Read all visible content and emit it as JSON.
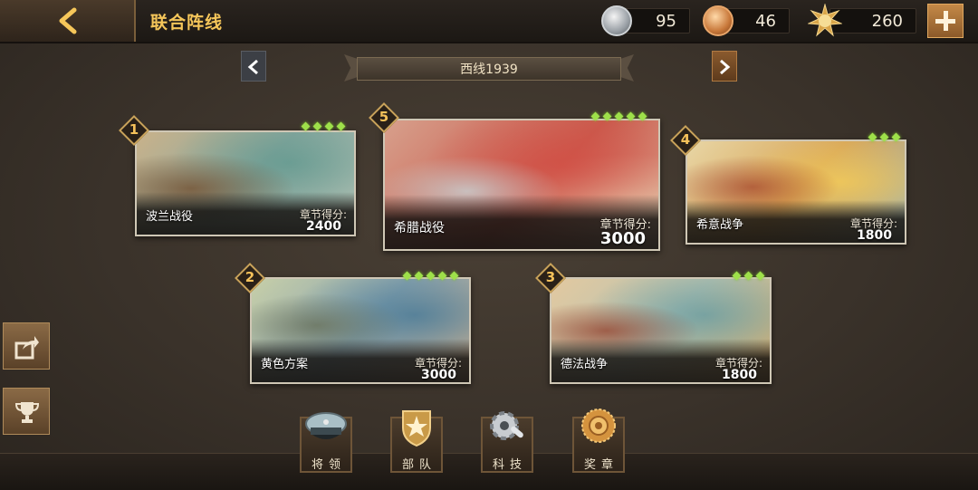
{
  "header": {
    "title": "联合阵线",
    "resources": [
      {
        "icon": "silver-medal-icon",
        "value": "95"
      },
      {
        "icon": "bronze-medal-icon",
        "value": "46"
      },
      {
        "icon": "gold-star-badge-icon",
        "value": "260"
      }
    ]
  },
  "region": {
    "label": "西线1939"
  },
  "score_label": "章节得分:",
  "chapters": [
    {
      "num": "1",
      "name": "波兰战役",
      "score": "2400",
      "stars": 4
    },
    {
      "num": "5",
      "name": "希腊战役",
      "score": "3000",
      "stars": 5
    },
    {
      "num": "4",
      "name": "希意战争",
      "score": "1800",
      "stars": 3
    },
    {
      "num": "2",
      "name": "黄色方案",
      "score": "3000",
      "stars": 5
    },
    {
      "num": "3",
      "name": "德法战争",
      "score": "1800",
      "stars": 3
    }
  ],
  "menu": [
    {
      "label": "将领",
      "icon": "officer-cap-icon"
    },
    {
      "label": "部队",
      "icon": "unit-emblem-icon"
    },
    {
      "label": "科技",
      "icon": "gear-wrench-icon"
    },
    {
      "label": "奖章",
      "icon": "medal-icon"
    }
  ],
  "side": [
    {
      "icon": "share-icon"
    },
    {
      "icon": "trophy-icon"
    }
  ]
}
